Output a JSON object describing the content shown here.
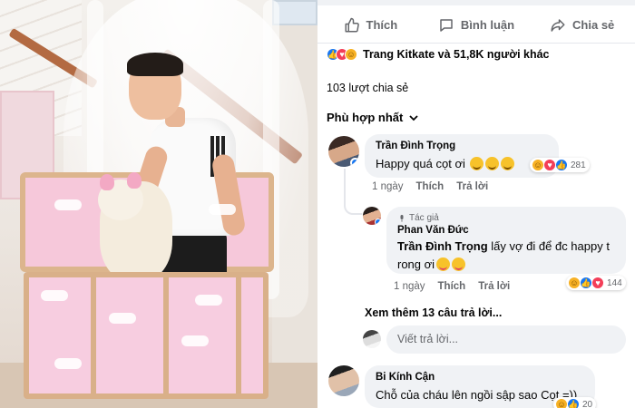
{
  "photo": {
    "alt": "photo"
  },
  "actions": {
    "like_label": "Thích",
    "comment_label": "Bình luận",
    "share_label": "Chia sẻ"
  },
  "reactions_summary": {
    "icons": [
      "like",
      "love",
      "haha"
    ],
    "text": "Trang Kitkate và 51,8K người khác"
  },
  "shares_text": "103 lượt chia sẻ",
  "sort_label": "Phù hợp nhất",
  "comments": [
    {
      "author": "Trần Đình Trọng",
      "text": "Happy quá cọt ơi",
      "emoji_count": 3,
      "reaction_icons": [
        "haha",
        "love",
        "like"
      ],
      "reaction_count": "281",
      "time": "1 ngày",
      "like_label": "Thích",
      "reply_label": "Trả lời"
    },
    {
      "author_tag": "Tác giả",
      "author": "Phan Văn Đức",
      "mention": "Trần Đình Trọng",
      "text": "lấy vợ đi để đc happy t rong ơi",
      "reaction_icons": [
        "haha",
        "like",
        "love"
      ],
      "reaction_count": "144",
      "time": "1 ngày",
      "like_label": "Thích",
      "reply_label": "Trả lời"
    },
    {
      "author": "Bi Kính Cận",
      "text": "Chỗ của cháu lên ngồi sập sao Cọt =))",
      "reaction_icons": [
        "haha",
        "like"
      ],
      "reaction_count": "20"
    }
  ],
  "more_replies": "Xem thêm 13 câu trả lời...",
  "reply_placeholder": "Viết trả lời...",
  "colors": {
    "accent": "#1877f2",
    "love": "#f33e58",
    "haha": "#f7b125",
    "bubble": "#f0f2f5",
    "muted": "#65676b"
  }
}
